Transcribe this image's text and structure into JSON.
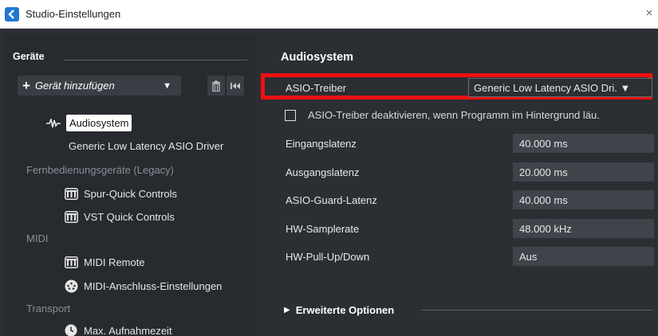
{
  "window": {
    "title": "Studio-Einstellungen",
    "close_glyph": "×",
    "app_icon": "cubase-logo-icon"
  },
  "left_panel": {
    "heading": "Geräte",
    "add_device": {
      "plus": "+",
      "label": "Gerät hinzufügen",
      "arrow": "▼"
    },
    "tree": [
      {
        "label": "Audiosystem",
        "icon": "waveform-icon",
        "selected": true
      },
      {
        "label": "Generic Low Latency ASIO Driver"
      },
      {
        "label": "Fernbedienungsgeräte (Legacy)",
        "dim": true
      },
      {
        "label": "Spur-Quick Controls",
        "icon": "controller-icon"
      },
      {
        "label": "VST Quick Controls",
        "icon": "controller-icon"
      },
      {
        "label": "MIDI",
        "dim": true
      },
      {
        "label": "MIDI Remote",
        "icon": "controller-icon"
      },
      {
        "label": "MIDI-Anschluss-Einstellungen",
        "icon": "midi-port-icon"
      },
      {
        "label": "Transport",
        "dim": true
      },
      {
        "label": "Max. Aufnahmezeit",
        "icon": "clock-icon"
      }
    ]
  },
  "right_panel": {
    "title": "Audiosystem",
    "asio_driver": {
      "label": "ASIO-Treiber",
      "value": "Generic Low Latency ASIO Dri. ▼"
    },
    "checkbox_label": "ASIO-Treiber deaktivieren, wenn Programm im Hintergrund läu.",
    "rows": [
      {
        "label": "Eingangslatenz",
        "value": "40.000 ms"
      },
      {
        "label": "Ausgangslatenz",
        "value": "20.000 ms"
      },
      {
        "label": "ASIO-Guard-Latenz",
        "value": "40.000 ms"
      },
      {
        "label": "HW-Samplerate",
        "value": "48.000 kHz"
      },
      {
        "label": "HW-Pull-Up/Down",
        "value": "Aus"
      }
    ],
    "advanced": {
      "triangle": "▶",
      "label": "Erweiterte Optionen"
    }
  },
  "colors": {
    "highlight_border": "#ee1010",
    "background": "#2b2e33",
    "value_box": "#3f434a"
  }
}
